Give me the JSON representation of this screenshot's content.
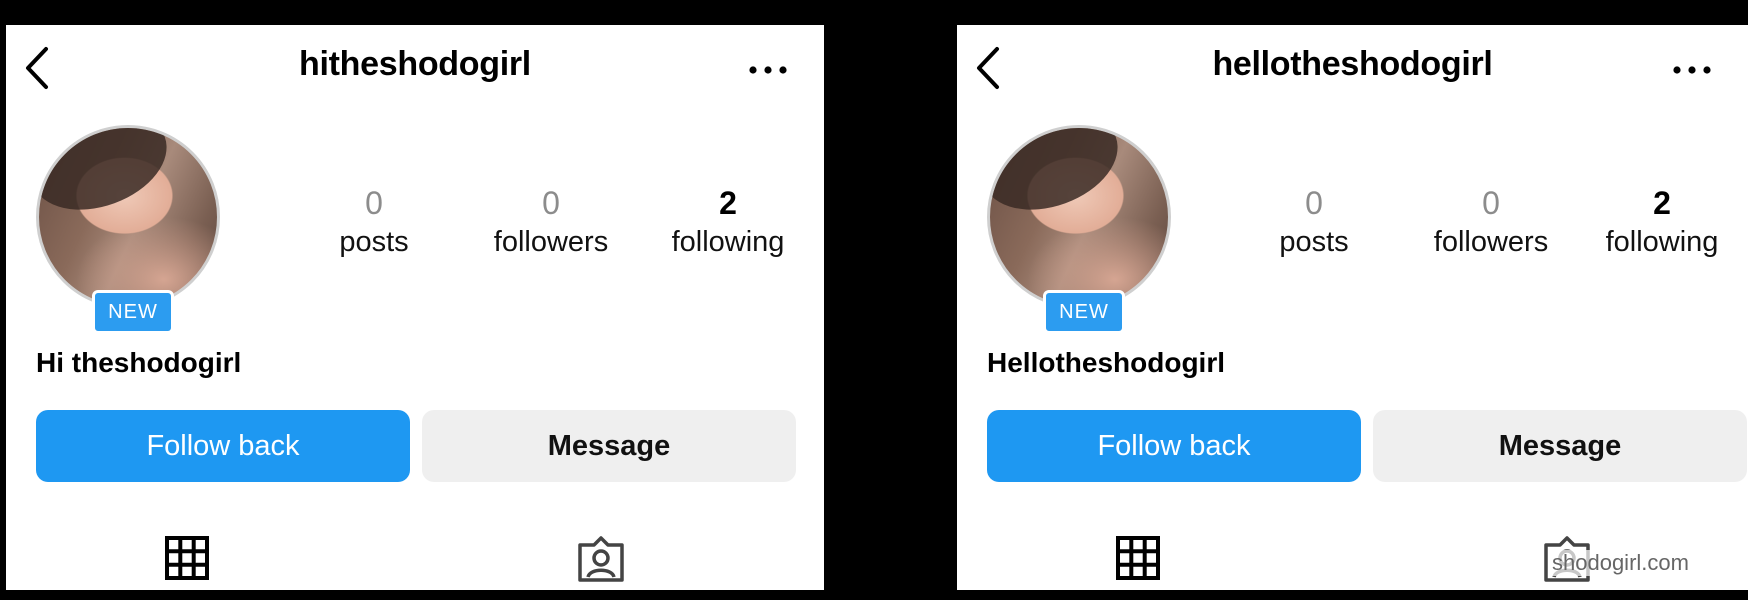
{
  "panels": [
    {
      "username": "hitheshodogirl",
      "stats": {
        "posts": {
          "value": "0",
          "label": "posts"
        },
        "followers": {
          "value": "0",
          "label": "followers"
        },
        "following": {
          "value": "2",
          "label": "following"
        }
      },
      "badge": "NEW",
      "display_name": "Hi theshodogirl",
      "buttons": {
        "follow": "Follow back",
        "message": "Message"
      },
      "icons": {
        "back": "chevron-left-icon",
        "more": "more-horizontal-icon",
        "grid": "grid-icon",
        "tagged": "tagged-icon"
      }
    },
    {
      "username": "hellotheshodogirl",
      "stats": {
        "posts": {
          "value": "0",
          "label": "posts"
        },
        "followers": {
          "value": "0",
          "label": "followers"
        },
        "following": {
          "value": "2",
          "label": "following"
        }
      },
      "badge": "NEW",
      "display_name": "Hellotheshodogirl",
      "buttons": {
        "follow": "Follow back",
        "message": "Message"
      },
      "icons": {
        "back": "chevron-left-icon",
        "more": "more-horizontal-icon",
        "grid": "grid-icon",
        "tagged": "tagged-icon"
      },
      "watermark": "shodogirl.com"
    }
  ],
  "colors": {
    "accent": "#1e98f2",
    "badge": "#2c9cf0",
    "secondary_button": "#efefef",
    "muted_text": "#8c8c8c"
  }
}
